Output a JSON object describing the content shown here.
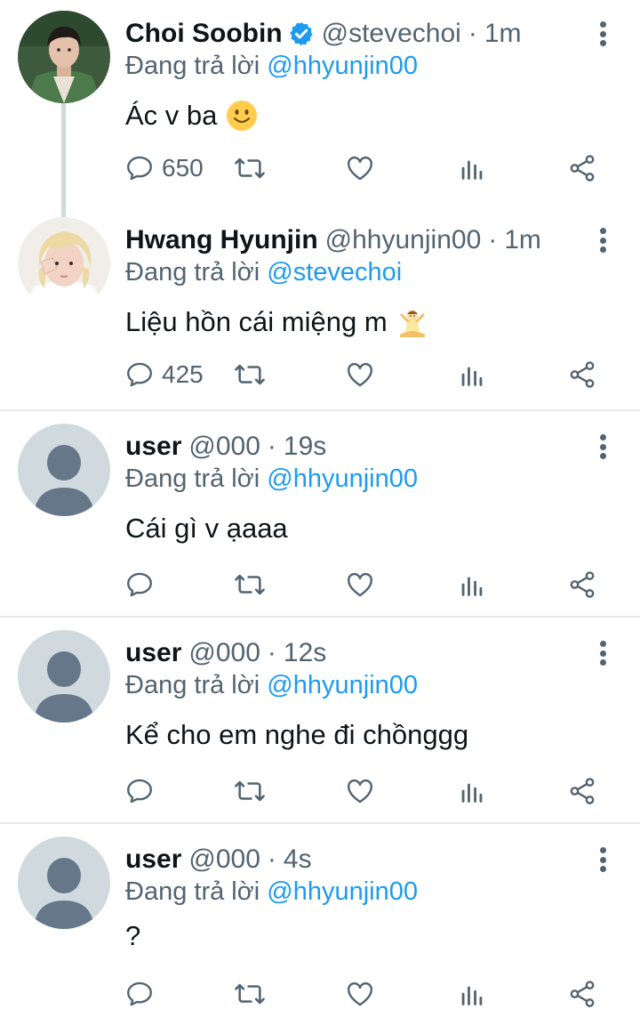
{
  "tweets": [
    {
      "name": "Choi Soobin",
      "verified": true,
      "handle": "@stevechoi",
      "separator": "·",
      "time": "1m",
      "reply_prefix": "Đang trả lời ",
      "reply_to": "@hhyunjin00",
      "text": "Ác v ba",
      "emoji": "slightly-smiling-face",
      "reply_count": "650"
    },
    {
      "name": "Hwang Hyunjin",
      "verified": false,
      "handle": "@hhyunjin00",
      "separator": "·",
      "time": "1m",
      "reply_prefix": "Đang trả lời ",
      "reply_to": "@stevechoi",
      "text": "Liệu hồn cái miệng m",
      "emoji": "person-in-lotus-position",
      "reply_count": "425"
    },
    {
      "name": "user",
      "verified": false,
      "handle": "@000",
      "separator": "·",
      "time": "19s",
      "reply_prefix": "Đang trả lời ",
      "reply_to": "@hhyunjin00",
      "text": "Cái gì v ạaaa",
      "reply_count": ""
    },
    {
      "name": "user",
      "verified": false,
      "handle": "@000",
      "separator": "·",
      "time": "12s",
      "reply_prefix": "Đang trả lời ",
      "reply_to": "@hhyunjin00",
      "text": "Kể cho em nghe đi chồnggg",
      "reply_count": ""
    },
    {
      "name": "user",
      "verified": false,
      "handle": "@000",
      "separator": "·",
      "time": "4s",
      "reply_prefix": "Đang trả lời ",
      "reply_to": "@hhyunjin00",
      "text": "?",
      "reply_count": ""
    }
  ],
  "icons": {
    "reply": "reply-icon",
    "retweet": "retweet-icon",
    "like": "like-icon",
    "analytics": "analytics-icon",
    "share": "share-icon",
    "more": "more-options-icon",
    "verified": "verified-badge-icon"
  },
  "colors": {
    "primary_text": "#0f1419",
    "secondary_text": "#536471",
    "link": "#1d9bf0",
    "divider": "#e6e9ec",
    "thread_line": "#cfd9de",
    "default_avatar_bg": "#cfd9de",
    "default_avatar_fg": "#66778a"
  }
}
